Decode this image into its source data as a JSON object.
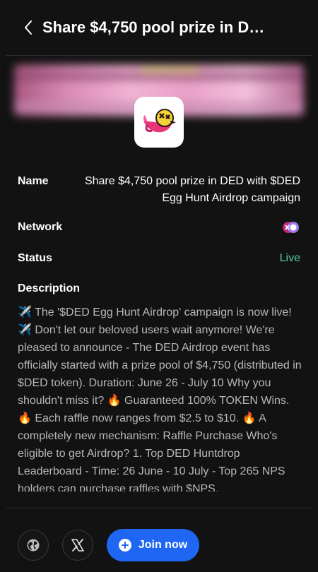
{
  "header": {
    "title": "Share $4,750 pool prize in D…"
  },
  "details": {
    "name_label": "Name",
    "name_value": "Share $4,750 pool prize in DED with $DED Egg Hunt Airdrop campaign",
    "network_label": "Network",
    "network_icon": "network-logo-icon",
    "status_label": "Status",
    "status_value": "Live",
    "status_color": "#4fd1a5"
  },
  "description": {
    "label": "Description",
    "text": "✈️ The '$DED Egg Hunt Airdrop' campaign is now live! ✈️ Don't let our beloved users wait anymore! We're pleased to announce - The DED Airdrop event has officially started with a prize pool of $4,750 (distributed in $DED token). Duration: June 26 - July 10 Why you shouldn't miss it? 🔥 Guaranteed 100% TOKEN Wins. 🔥 Each raffle now ranges from $2.5 to $10. 🔥 A completely new mechanism: Raffle Purchase Who's eligible to get Airdrop? 1. Top DED Huntdrop Leaderboard - Time: 26 June - 10 July - Top 265 NPS holders can purchase raffles with $NPS."
  },
  "footer": {
    "globe_icon": "globe-icon",
    "x_icon": "x-icon",
    "join_label": "Join now",
    "join_color": "#1f66f2"
  }
}
